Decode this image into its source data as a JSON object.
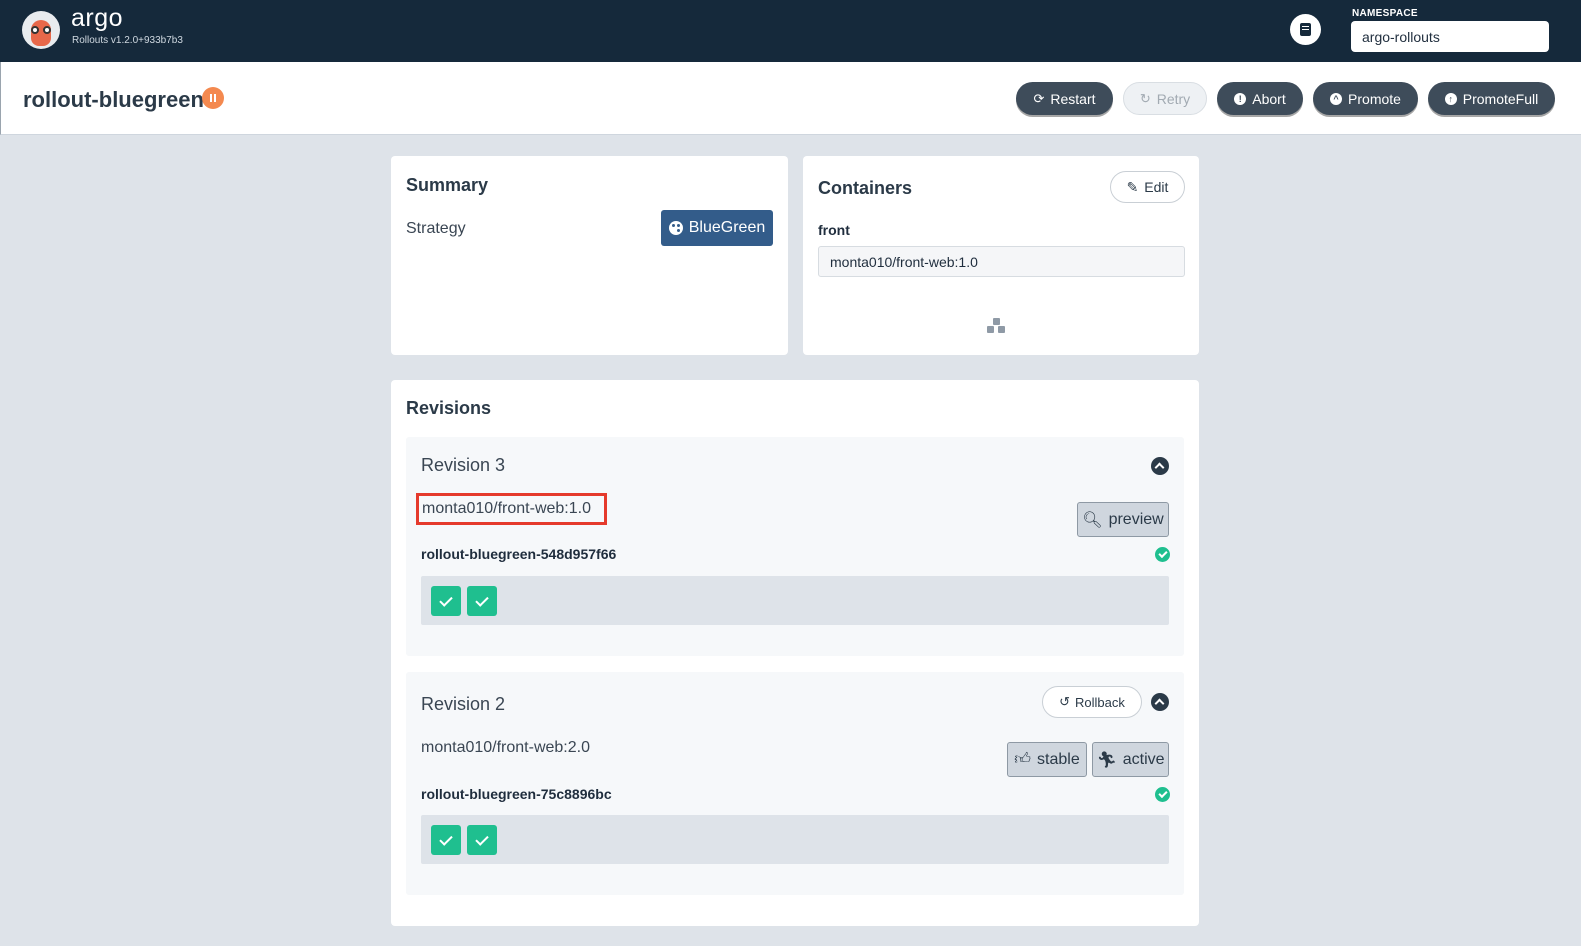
{
  "app": {
    "brand": "argo",
    "version": "Rollouts v1.2.0+933b7b3",
    "namespace_label": "NAMESPACE",
    "namespace_value": "argo-rollouts"
  },
  "header": {
    "title": "rollout-bluegreen",
    "status": "paused",
    "actions": {
      "restart": "Restart",
      "retry": "Retry",
      "abort": "Abort",
      "promote": "Promote",
      "promote_full": "PromoteFull"
    }
  },
  "summary": {
    "title": "Summary",
    "strategy_label": "Strategy",
    "strategy_value": "BlueGreen"
  },
  "containers": {
    "title": "Containers",
    "edit_label": "Edit",
    "items": [
      {
        "name": "front",
        "image": "monta010/front-web:1.0"
      }
    ]
  },
  "revisions": {
    "title": "Revisions",
    "items": [
      {
        "title": "Revision 3",
        "image": "monta010/front-web:1.0",
        "replicaset": "rollout-bluegreen-548d957f66",
        "tags": [
          "preview"
        ],
        "pods": 2
      },
      {
        "title": "Revision 2",
        "image": "monta010/front-web:2.0",
        "replicaset": "rollout-bluegreen-75c8896bc",
        "rollback_label": "Rollback",
        "tags": [
          "stable",
          "active"
        ],
        "pods": 2
      }
    ]
  },
  "colors": {
    "nav_bg": "#15293b",
    "button_dark": "#3e4c5a",
    "strategy_blue": "#335c8a",
    "success_green": "#1fbf8f",
    "pause_orange": "#f4894f",
    "highlight_red": "#e53a2c"
  }
}
